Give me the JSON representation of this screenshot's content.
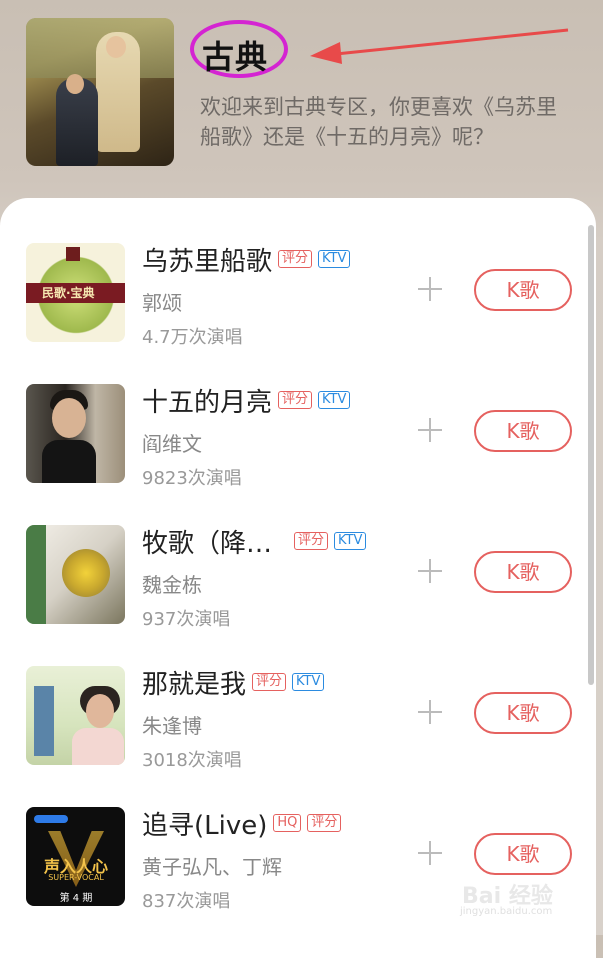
{
  "header": {
    "title": "古典",
    "description": "欢迎来到古典专区，你更喜欢《乌苏里船歌》还是《十五的月亮》呢？"
  },
  "songs": [
    {
      "name": "乌苏里船歌",
      "artist": "郭颂",
      "plays": "4.7万次演唱",
      "tags": [
        "评分",
        "KTV"
      ],
      "button": "K歌",
      "thumb_text": "民歌·宝典"
    },
    {
      "name": "十五的月亮",
      "artist": "阎维文",
      "plays": "9823次演唱",
      "tags": [
        "评分",
        "KTV"
      ],
      "button": "K歌"
    },
    {
      "name": "牧歌（降…",
      "artist": "魏金栋",
      "plays": "937次演唱",
      "tags": [
        "评分",
        "KTV"
      ],
      "button": "K歌"
    },
    {
      "name": "那就是我",
      "artist": "朱逢博",
      "plays": "3018次演唱",
      "tags": [
        "评分",
        "KTV"
      ],
      "button": "K歌"
    },
    {
      "name": "追寻(Live)",
      "artist": "黄子弘凡、丁辉",
      "plays": "837次演唱",
      "tags": [
        "HQ",
        "评分"
      ],
      "button": "K歌",
      "thumb_text": "声入人心",
      "thumb_sub": "SUPER-VOCAL",
      "thumb_ep": "第 4 期"
    }
  ],
  "watermark": {
    "text": "Bai 经验",
    "sub": "jingyan.baidu.com"
  },
  "colors": {
    "accent": "#e5615f",
    "ktv": "#2b8be0",
    "highlight_ring": "#d424d2",
    "arrow": "#e84a4a"
  }
}
